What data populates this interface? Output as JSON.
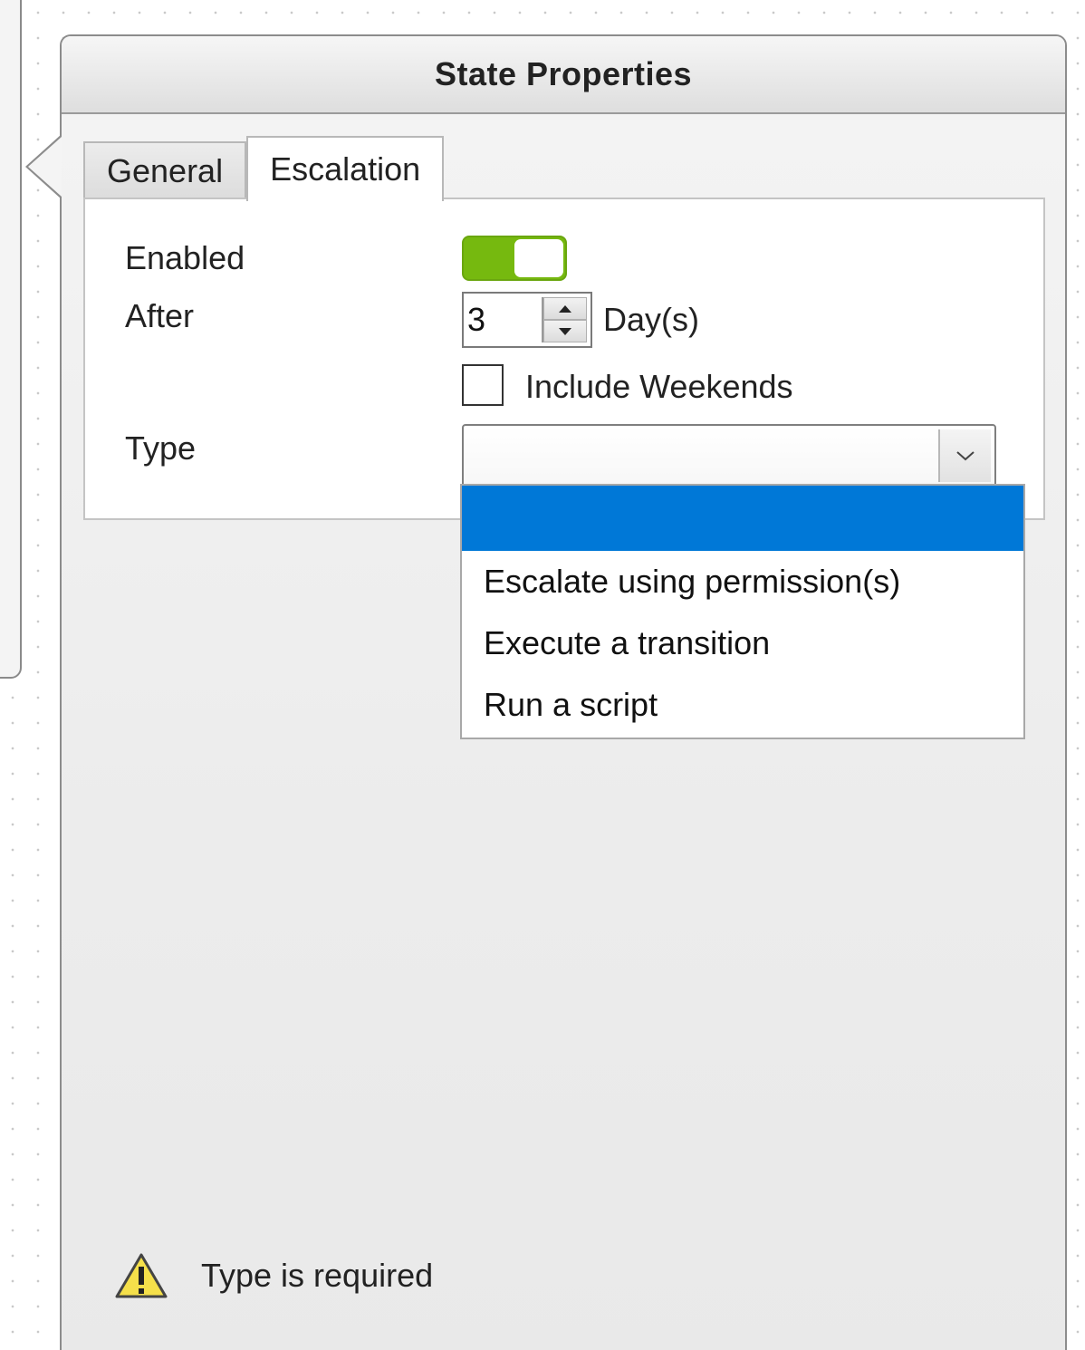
{
  "panel": {
    "title": "State Properties"
  },
  "tabs": [
    {
      "label": "General",
      "active": false
    },
    {
      "label": "Escalation",
      "active": true
    }
  ],
  "escalation": {
    "enabled_label": "Enabled",
    "enabled": true,
    "after_label": "After",
    "after_value": "3",
    "after_unit": "Day(s)",
    "include_weekends_label": "Include Weekends",
    "include_weekends": false,
    "type_label": "Type",
    "type_value": ""
  },
  "type_options": [
    {
      "label": "",
      "selected": true
    },
    {
      "label": "Escalate using permission(s)",
      "selected": false
    },
    {
      "label": "Execute a transition",
      "selected": false
    },
    {
      "label": "Run a script",
      "selected": false
    }
  ],
  "validation": {
    "icon": "warning-icon",
    "message": "Type is required"
  },
  "colors": {
    "toggle_on": "#76b90f",
    "selection": "#0078d7",
    "warning": "#f5e04a"
  }
}
